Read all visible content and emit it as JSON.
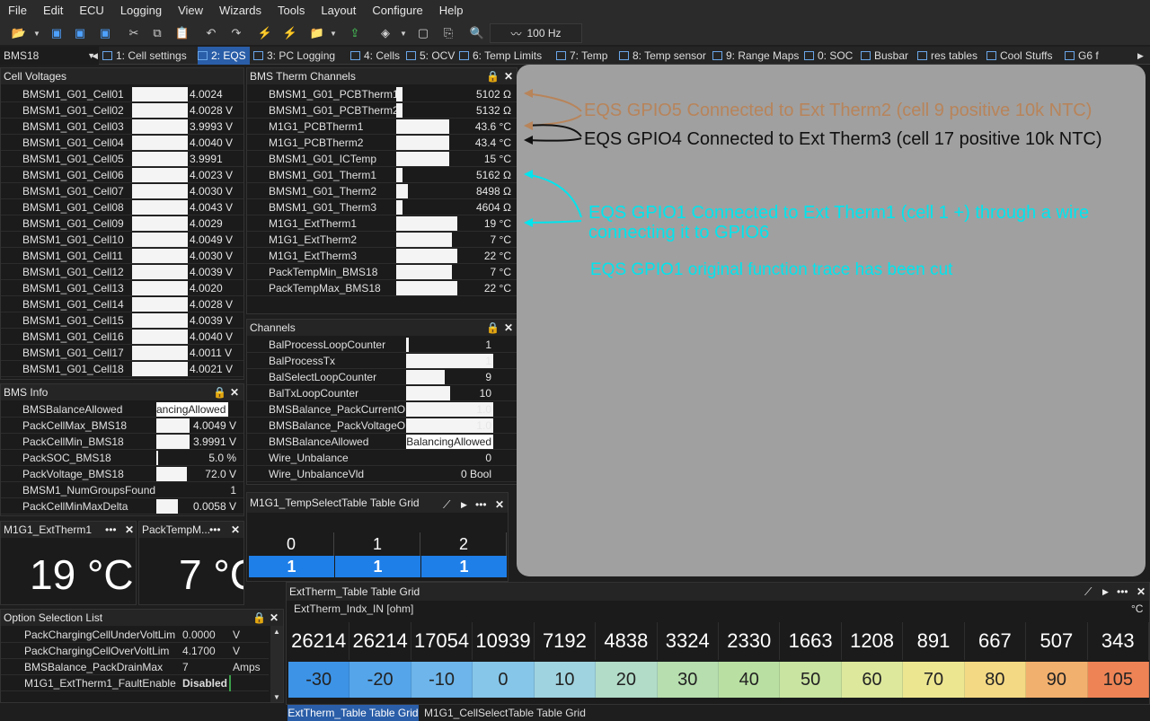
{
  "menu": [
    "File",
    "Edit",
    "ECU",
    "Logging",
    "View",
    "Wizards",
    "Tools",
    "Layout",
    "Configure",
    "Help"
  ],
  "toolbar": {
    "rate": "100 Hz"
  },
  "ecu_selector": "BMS18",
  "tabs": [
    "1: Cell settings",
    "2: EQS",
    "3: PC Logging",
    "4: Cells",
    "5: OCV",
    "6: Temp Limits",
    "7: Temp",
    "8: Temp sensor",
    "9: Range Maps",
    "0: SOC",
    "Busbar",
    "res tables",
    "Cool Stuffs",
    "G6 f"
  ],
  "cell_voltages": {
    "title": "Cell Voltages",
    "rows": [
      {
        "name": "BMSM1_G01_Cell01",
        "value": "4.0024"
      },
      {
        "name": "BMSM1_G01_Cell02",
        "value": "4.0028 V"
      },
      {
        "name": "BMSM1_G01_Cell03",
        "value": "3.9993 V"
      },
      {
        "name": "BMSM1_G01_Cell04",
        "value": "4.0040 V"
      },
      {
        "name": "BMSM1_G01_Cell05",
        "value": "3.9991"
      },
      {
        "name": "BMSM1_G01_Cell06",
        "value": "4.0023 V"
      },
      {
        "name": "BMSM1_G01_Cell07",
        "value": "4.0030 V"
      },
      {
        "name": "BMSM1_G01_Cell08",
        "value": "4.0043 V"
      },
      {
        "name": "BMSM1_G01_Cell09",
        "value": "4.0029"
      },
      {
        "name": "BMSM1_G01_Cell10",
        "value": "4.0049 V"
      },
      {
        "name": "BMSM1_G01_Cell11",
        "value": "4.0030 V"
      },
      {
        "name": "BMSM1_G01_Cell12",
        "value": "4.0039 V"
      },
      {
        "name": "BMSM1_G01_Cell13",
        "value": "4.0020"
      },
      {
        "name": "BMSM1_G01_Cell14",
        "value": "4.0028 V"
      },
      {
        "name": "BMSM1_G01_Cell15",
        "value": "4.0039 V"
      },
      {
        "name": "BMSM1_G01_Cell16",
        "value": "4.0040 V"
      },
      {
        "name": "BMSM1_G01_Cell17",
        "value": "4.0011 V"
      },
      {
        "name": "BMSM1_G01_Cell18",
        "value": "4.0021 V"
      }
    ]
  },
  "bms_info": {
    "title": "BMS Info",
    "rows": [
      {
        "name": "BMSBalanceAllowed",
        "value": "ancingAllowed",
        "bar": 0
      },
      {
        "name": "PackCellMax_BMS18",
        "value": "4.0049 V",
        "bar": 0.92
      },
      {
        "name": "PackCellMin_BMS18",
        "value": "3.9991 V",
        "bar": 0.92
      },
      {
        "name": "PackSOC_BMS18",
        "value": "5.0 %",
        "bar": 0.05
      },
      {
        "name": "PackVoltage_BMS18",
        "value": "72.0 V",
        "bar": 0.85
      },
      {
        "name": "BMSM1_NumGroupsFound",
        "value": "1",
        "bar": 0
      },
      {
        "name": "PackCellMinMaxDelta",
        "value": "0.0058 V",
        "bar": 0.6
      }
    ]
  },
  "gauges": [
    {
      "title": "M1G1_ExtTherm1",
      "value": "19 °C"
    },
    {
      "title": "PackTempM...",
      "value": "7 °C"
    }
  ],
  "option_list": {
    "title": "Option Selection List",
    "rows": [
      {
        "name": "PackChargingCellUnderVoltLim",
        "value": "0.0000",
        "unit": "V"
      },
      {
        "name": "PackChargingCellOverVoltLim",
        "value": "4.1700",
        "unit": "V"
      },
      {
        "name": "BMSBalance_PackDrainMax",
        "value": "7",
        "unit": "Amps"
      },
      {
        "name": "M1G1_ExtTherm1_FaultEnable",
        "value": "Disabled",
        "unit": ""
      }
    ]
  },
  "therm_channels": {
    "title": "BMS Therm Channels",
    "rows": [
      {
        "name": "BMSM1_G01_PCBTherm1",
        "value": "5102 Ω",
        "bar": 0.05
      },
      {
        "name": "BMSM1_G01_PCBTherm2",
        "value": "5132 Ω",
        "bar": 0.05
      },
      {
        "name": "M1G1_PCBTherm1",
        "value": "43.6 °C",
        "bar": 0.45
      },
      {
        "name": "M1G1_PCBTherm2",
        "value": "43.4 °C",
        "bar": 0.45
      },
      {
        "name": "BMSM1_G01_ICTemp",
        "value": "15 °C",
        "bar": 0.45
      },
      {
        "name": "BMSM1_G01_Therm1",
        "value": "5162 Ω",
        "bar": 0.05
      },
      {
        "name": "BMSM1_G01_Therm2",
        "value": "8498 Ω",
        "bar": 0.1
      },
      {
        "name": "BMSM1_G01_Therm3",
        "value": "4604 Ω",
        "bar": 0.05
      },
      {
        "name": "M1G1_ExtTherm1",
        "value": "19 °C",
        "bar": 0.52
      },
      {
        "name": "M1G1_ExtTherm2",
        "value": "7 °C",
        "bar": 0.48
      },
      {
        "name": "M1G1_ExtTherm3",
        "value": "22 °C",
        "bar": 0.52
      },
      {
        "name": "PackTempMin_BMS18",
        "value": "7 °C",
        "bar": 0.48
      },
      {
        "name": "PackTempMax_BMS18",
        "value": "22 °C",
        "bar": 0.52
      }
    ]
  },
  "channels": {
    "title": "Channels",
    "rows": [
      {
        "name": "BalProcessLoopCounter",
        "value": "1",
        "bar": 0.03
      },
      {
        "name": "BalProcessTx",
        "value": "1",
        "bar": 1
      },
      {
        "name": "BalSelectLoopCounter",
        "value": "9",
        "bar": 0.44
      },
      {
        "name": "BalTxLoopCounter",
        "value": "10",
        "bar": 0.5
      },
      {
        "name": "BMSBalance_PackCurrentOK",
        "value": "1.0",
        "bar": 1
      },
      {
        "name": "BMSBalance_PackVoltageOK",
        "value": "1.0",
        "bar": 1
      },
      {
        "name": "BMSBalanceAllowed",
        "value": "BalancingAllowed",
        "bar": 1
      },
      {
        "name": "Wire_Unbalance",
        "value": "0",
        "bar": 0
      },
      {
        "name": "Wire_UnbalanceVld",
        "value": "0 Bool",
        "bar": 0
      }
    ]
  },
  "temp_select_grid": {
    "title": "M1G1_TempSelectTable Table Grid",
    "headers": [
      "0",
      "1",
      "2"
    ],
    "values": [
      "1",
      "1",
      "1"
    ]
  },
  "annotations": {
    "a1": "EQS GPIO5 Connected to Ext Therm2 (cell 9 positive 10k NTC)",
    "a2": "EQS GPIO4 Connected to Ext Therm3 (cell 17 positive 10k NTC)",
    "a3a": "EQS GPIO1 Connected to Ext Therm1 (cell 1 +) through a wire",
    "a3b": "connecting it to GPIO6",
    "a4": "EQS GPIO1 original function trace has been cut",
    "colors": {
      "orange": "#b8845a",
      "black": "#111111",
      "cyan": "#00e5ee"
    }
  },
  "ext_grid": {
    "title": "ExtTherm_Table Table Grid",
    "axis_label": "ExtTherm_Indx_IN [ohm]",
    "unit": "°C",
    "headers": [
      "26214",
      "26214",
      "17054",
      "10939",
      "7192",
      "4838",
      "3324",
      "2330",
      "1663",
      "1208",
      "891",
      "667",
      "507",
      "343"
    ],
    "values": [
      "-30",
      "-20",
      "-10",
      "0",
      "10",
      "20",
      "30",
      "40",
      "50",
      "60",
      "70",
      "80",
      "90",
      "105"
    ],
    "colors": [
      "#3d93e6",
      "#55a5ea",
      "#6db5ea",
      "#86c6e8",
      "#9fd3df",
      "#b2dcc8",
      "#b6deae",
      "#b9e0a2",
      "#c9e4a0",
      "#dde89c",
      "#ede691",
      "#f4d984",
      "#f2b06e",
      "#ee8456"
    ]
  },
  "bottom_tabs": [
    "ExtTherm_Table Table Grid",
    "M1G1_CellSelectTable Table Grid"
  ]
}
